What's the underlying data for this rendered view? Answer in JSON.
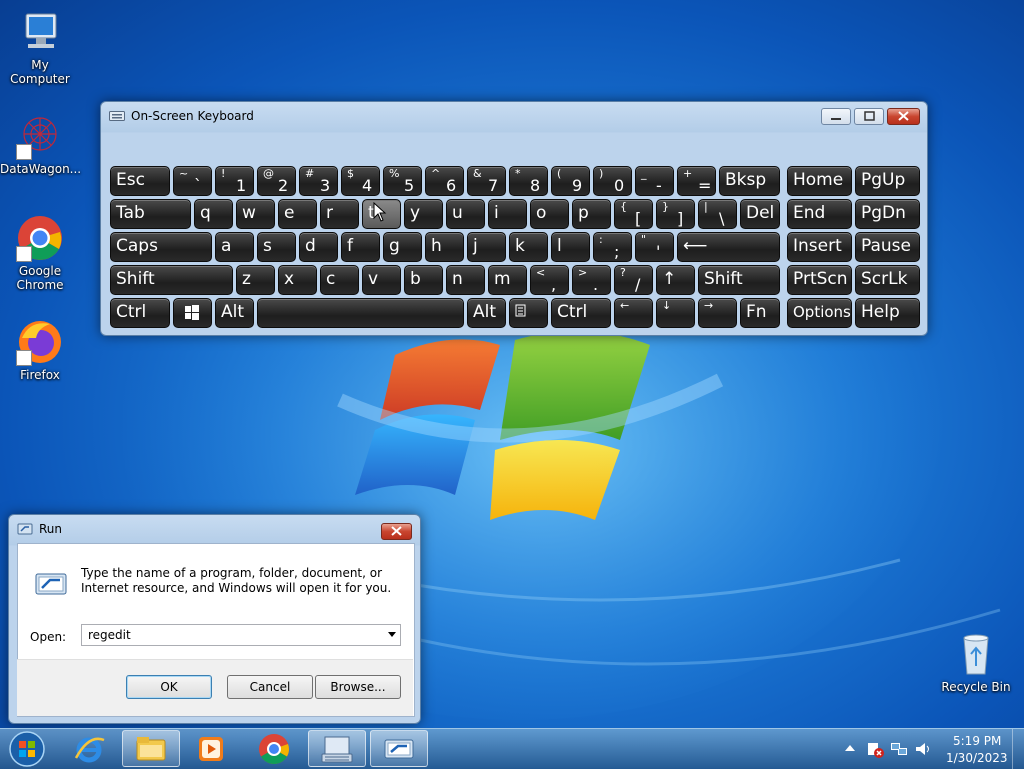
{
  "desktop": {
    "icons": [
      {
        "label": "My Computer",
        "icon": "computer-icon"
      },
      {
        "label": "DataWagon...",
        "icon": "datawagon-icon"
      },
      {
        "label": "Google Chrome",
        "icon": "chrome-icon"
      },
      {
        "label": "Firefox",
        "icon": "firefox-icon"
      },
      {
        "label": "Recycle Bin",
        "icon": "recycle-bin-icon"
      }
    ]
  },
  "osk": {
    "title": "On-Screen Keyboard",
    "rows": [
      [
        {
          "top": "~",
          "bot": "`"
        },
        {
          "top": "!",
          "bot": "1"
        },
        {
          "top": "@",
          "bot": "2"
        },
        {
          "top": "#",
          "bot": "3"
        },
        {
          "top": "$",
          "bot": "4"
        },
        {
          "top": "%",
          "bot": "5"
        },
        {
          "top": "^",
          "bot": "6"
        },
        {
          "top": "&",
          "bot": "7"
        },
        {
          "top": "*",
          "bot": "8"
        },
        {
          "top": "(",
          "bot": "9"
        },
        {
          "top": ")",
          "bot": "0"
        },
        {
          "top": "_",
          "bot": "-"
        },
        {
          "top": "+",
          "bot": "="
        }
      ],
      [
        "q",
        "w",
        "e",
        "r",
        "t",
        "y",
        "u",
        "i",
        "o",
        "p"
      ],
      [
        {
          "top": "{",
          "bot": "["
        },
        {
          "top": "}",
          "bot": "]"
        },
        {
          "top": "|",
          "bot": "\\"
        }
      ],
      [
        "a",
        "s",
        "d",
        "f",
        "g",
        "h",
        "j",
        "k",
        "l"
      ],
      [
        {
          "top": ":",
          "bot": ";"
        },
        {
          "top": "\"",
          "bot": "'"
        }
      ],
      [
        "z",
        "x",
        "c",
        "v",
        "b",
        "n",
        "m"
      ],
      [
        {
          "top": "<",
          "bot": ","
        },
        {
          "top": ">",
          "bot": "."
        },
        {
          "top": "?",
          "bot": "/"
        }
      ]
    ],
    "labels": {
      "esc": "Esc",
      "bksp": "Bksp",
      "home": "Home",
      "pgup": "PgUp",
      "tab": "Tab",
      "del": "Del",
      "end": "End",
      "pgdn": "PgDn",
      "caps": "Caps",
      "insert": "Insert",
      "pause": "Pause",
      "shift": "Shift",
      "prtscn": "PrtScn",
      "scrlk": "ScrLk",
      "ctrl": "Ctrl",
      "alt": "Alt",
      "fn": "Fn",
      "options": "Options",
      "help": "Help",
      "arrow_up": "↑",
      "arrow_left": "←",
      "arrow_down": "↓",
      "arrow_right": "→",
      "enter": "⟵"
    }
  },
  "run": {
    "title": "Run",
    "description": "Type the name of a program, folder, document, or Internet resource, and Windows will open it for you.",
    "open_label": "Open:",
    "open_value": "regedit",
    "ok": "OK",
    "cancel": "Cancel",
    "browse": "Browse..."
  },
  "taskbar": {
    "items": [
      "start-orb-icon",
      "internet-explorer-icon",
      "file-explorer-icon",
      "media-player-icon",
      "chrome-icon",
      "osk-icon",
      "run-icon"
    ],
    "time": "5:19 PM",
    "date": "1/30/2023"
  }
}
